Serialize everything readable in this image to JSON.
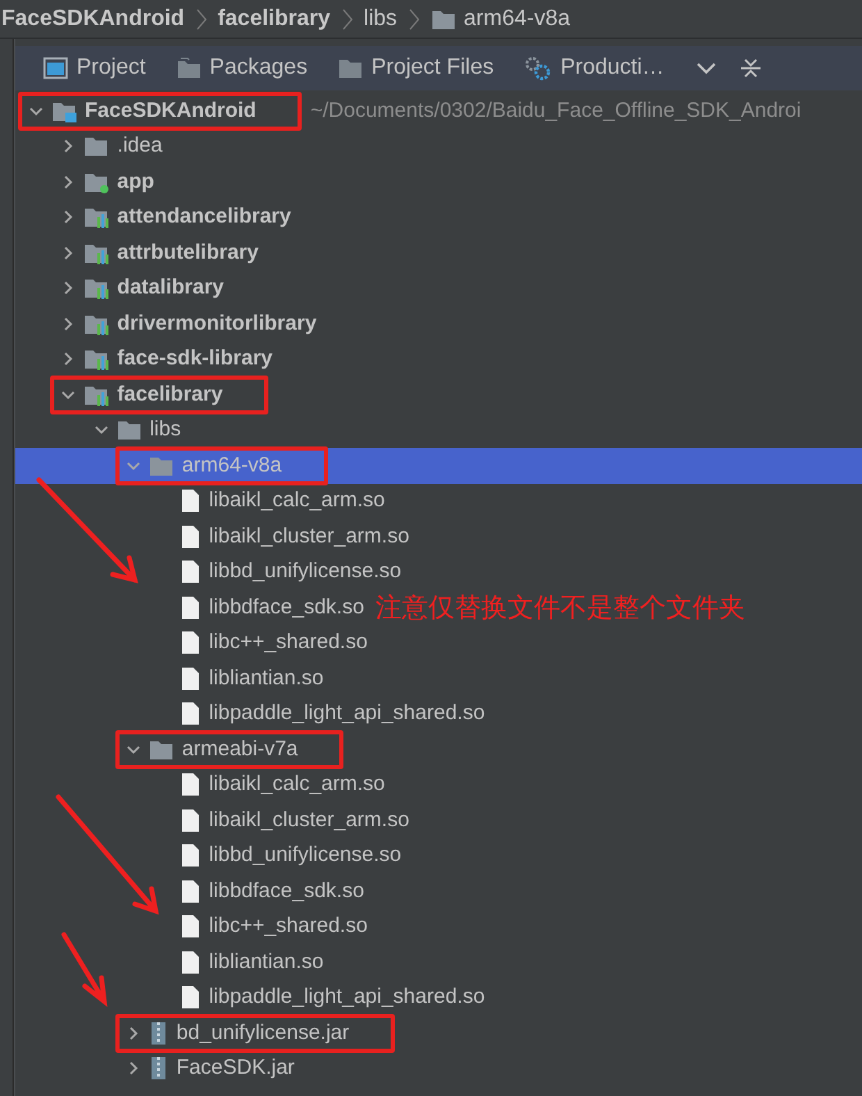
{
  "breadcrumb": [
    {
      "label": "FaceSDKAndroid",
      "kind": "module"
    },
    {
      "label": "facelibrary",
      "kind": "module"
    },
    {
      "label": "libs",
      "kind": "plain"
    },
    {
      "label": "arm64-v8a",
      "kind": "folder"
    }
  ],
  "toolbar": {
    "tabs": [
      {
        "label": "Project",
        "kind": "project"
      },
      {
        "label": "Packages",
        "kind": "packages"
      },
      {
        "label": "Project Files",
        "kind": "folder"
      },
      {
        "label": "Producti…",
        "kind": "production"
      }
    ]
  },
  "tree": [
    {
      "label": "FaceSDKAndroid",
      "kind": "root",
      "path": "~/Documents/0302/Baidu_Face_Offline_SDK_Androi",
      "expanded": true,
      "selected": false,
      "annotated": true,
      "children": [
        {
          "label": ".idea",
          "kind": "folder",
          "expanded": false,
          "selected": false,
          "annotated": false
        },
        {
          "label": "app",
          "kind": "app",
          "expanded": false,
          "selected": false,
          "annotated": false
        },
        {
          "label": "attendancelibrary",
          "kind": "module",
          "expanded": false,
          "selected": false,
          "annotated": false
        },
        {
          "label": "attrbutelibrary",
          "kind": "module",
          "expanded": false,
          "selected": false,
          "annotated": false
        },
        {
          "label": "datalibrary",
          "kind": "module",
          "expanded": false,
          "selected": false,
          "annotated": false
        },
        {
          "label": "drivermonitorlibrary",
          "kind": "module",
          "expanded": false,
          "selected": false,
          "annotated": false
        },
        {
          "label": "face-sdk-library",
          "kind": "module",
          "expanded": false,
          "selected": false,
          "annotated": false
        },
        {
          "label": "facelibrary",
          "kind": "module",
          "expanded": true,
          "selected": false,
          "annotated": true,
          "children": [
            {
              "label": "libs",
              "kind": "folder",
              "expanded": true,
              "selected": false,
              "annotated": false,
              "children": [
                {
                  "label": "arm64-v8a",
                  "kind": "folder",
                  "expanded": true,
                  "selected": true,
                  "annotated": true,
                  "children": [
                    {
                      "label": "libaikl_calc_arm.so",
                      "kind": "file",
                      "selected": false,
                      "annotated": false
                    },
                    {
                      "label": "libaikl_cluster_arm.so",
                      "kind": "file",
                      "selected": false,
                      "annotated": false
                    },
                    {
                      "label": "libbd_unifylicense.so",
                      "kind": "file",
                      "selected": false,
                      "annotated": false
                    },
                    {
                      "label": "libbdface_sdk.so",
                      "kind": "file",
                      "selected": false,
                      "annotated": false,
                      "note": "注意仅替换文件不是整个文件夹"
                    },
                    {
                      "label": "libc++_shared.so",
                      "kind": "file",
                      "selected": false,
                      "annotated": false
                    },
                    {
                      "label": "libliantian.so",
                      "kind": "file",
                      "selected": false,
                      "annotated": false
                    },
                    {
                      "label": "libpaddle_light_api_shared.so",
                      "kind": "file",
                      "selected": false,
                      "annotated": false
                    }
                  ]
                },
                {
                  "label": "armeabi-v7a",
                  "kind": "folder",
                  "expanded": true,
                  "selected": false,
                  "annotated": true,
                  "children": [
                    {
                      "label": "libaikl_calc_arm.so",
                      "kind": "file",
                      "selected": false,
                      "annotated": false
                    },
                    {
                      "label": "libaikl_cluster_arm.so",
                      "kind": "file",
                      "selected": false,
                      "annotated": false
                    },
                    {
                      "label": "libbd_unifylicense.so",
                      "kind": "file",
                      "selected": false,
                      "annotated": false
                    },
                    {
                      "label": "libbdface_sdk.so",
                      "kind": "file",
                      "selected": false,
                      "annotated": false
                    },
                    {
                      "label": "libc++_shared.so",
                      "kind": "file",
                      "selected": false,
                      "annotated": false
                    },
                    {
                      "label": "libliantian.so",
                      "kind": "file",
                      "selected": false,
                      "annotated": false
                    },
                    {
                      "label": "libpaddle_light_api_shared.so",
                      "kind": "file",
                      "selected": false,
                      "annotated": false
                    }
                  ]
                },
                {
                  "label": "bd_unifylicense.jar",
                  "kind": "jar",
                  "expanded": false,
                  "selected": false,
                  "annotated": true
                },
                {
                  "label": "FaceSDK.jar",
                  "kind": "jar",
                  "expanded": false,
                  "selected": false,
                  "annotated": false
                }
              ]
            }
          ]
        }
      ]
    }
  ]
}
